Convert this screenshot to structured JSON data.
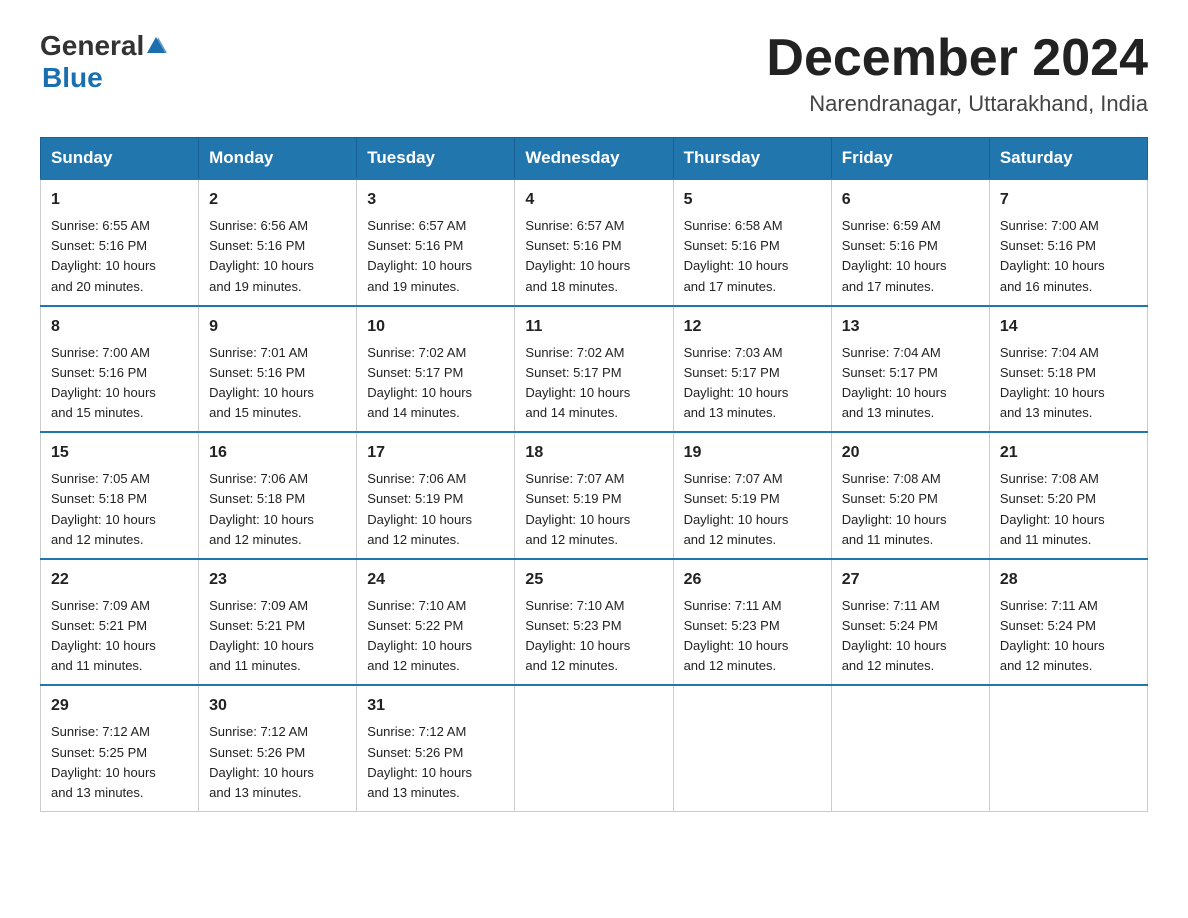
{
  "header": {
    "logo_text_general": "General",
    "logo_text_blue": "Blue",
    "month_year": "December 2024",
    "location": "Narendranagar, Uttarakhand, India"
  },
  "weekdays": [
    "Sunday",
    "Monday",
    "Tuesday",
    "Wednesday",
    "Thursday",
    "Friday",
    "Saturday"
  ],
  "weeks": [
    [
      {
        "day": "1",
        "sunrise": "6:55 AM",
        "sunset": "5:16 PM",
        "daylight": "10 hours and 20 minutes."
      },
      {
        "day": "2",
        "sunrise": "6:56 AM",
        "sunset": "5:16 PM",
        "daylight": "10 hours and 19 minutes."
      },
      {
        "day": "3",
        "sunrise": "6:57 AM",
        "sunset": "5:16 PM",
        "daylight": "10 hours and 19 minutes."
      },
      {
        "day": "4",
        "sunrise": "6:57 AM",
        "sunset": "5:16 PM",
        "daylight": "10 hours and 18 minutes."
      },
      {
        "day": "5",
        "sunrise": "6:58 AM",
        "sunset": "5:16 PM",
        "daylight": "10 hours and 17 minutes."
      },
      {
        "day": "6",
        "sunrise": "6:59 AM",
        "sunset": "5:16 PM",
        "daylight": "10 hours and 17 minutes."
      },
      {
        "day": "7",
        "sunrise": "7:00 AM",
        "sunset": "5:16 PM",
        "daylight": "10 hours and 16 minutes."
      }
    ],
    [
      {
        "day": "8",
        "sunrise": "7:00 AM",
        "sunset": "5:16 PM",
        "daylight": "10 hours and 15 minutes."
      },
      {
        "day": "9",
        "sunrise": "7:01 AM",
        "sunset": "5:16 PM",
        "daylight": "10 hours and 15 minutes."
      },
      {
        "day": "10",
        "sunrise": "7:02 AM",
        "sunset": "5:17 PM",
        "daylight": "10 hours and 14 minutes."
      },
      {
        "day": "11",
        "sunrise": "7:02 AM",
        "sunset": "5:17 PM",
        "daylight": "10 hours and 14 minutes."
      },
      {
        "day": "12",
        "sunrise": "7:03 AM",
        "sunset": "5:17 PM",
        "daylight": "10 hours and 13 minutes."
      },
      {
        "day": "13",
        "sunrise": "7:04 AM",
        "sunset": "5:17 PM",
        "daylight": "10 hours and 13 minutes."
      },
      {
        "day": "14",
        "sunrise": "7:04 AM",
        "sunset": "5:18 PM",
        "daylight": "10 hours and 13 minutes."
      }
    ],
    [
      {
        "day": "15",
        "sunrise": "7:05 AM",
        "sunset": "5:18 PM",
        "daylight": "10 hours and 12 minutes."
      },
      {
        "day": "16",
        "sunrise": "7:06 AM",
        "sunset": "5:18 PM",
        "daylight": "10 hours and 12 minutes."
      },
      {
        "day": "17",
        "sunrise": "7:06 AM",
        "sunset": "5:19 PM",
        "daylight": "10 hours and 12 minutes."
      },
      {
        "day": "18",
        "sunrise": "7:07 AM",
        "sunset": "5:19 PM",
        "daylight": "10 hours and 12 minutes."
      },
      {
        "day": "19",
        "sunrise": "7:07 AM",
        "sunset": "5:19 PM",
        "daylight": "10 hours and 12 minutes."
      },
      {
        "day": "20",
        "sunrise": "7:08 AM",
        "sunset": "5:20 PM",
        "daylight": "10 hours and 11 minutes."
      },
      {
        "day": "21",
        "sunrise": "7:08 AM",
        "sunset": "5:20 PM",
        "daylight": "10 hours and 11 minutes."
      }
    ],
    [
      {
        "day": "22",
        "sunrise": "7:09 AM",
        "sunset": "5:21 PM",
        "daylight": "10 hours and 11 minutes."
      },
      {
        "day": "23",
        "sunrise": "7:09 AM",
        "sunset": "5:21 PM",
        "daylight": "10 hours and 11 minutes."
      },
      {
        "day": "24",
        "sunrise": "7:10 AM",
        "sunset": "5:22 PM",
        "daylight": "10 hours and 12 minutes."
      },
      {
        "day": "25",
        "sunrise": "7:10 AM",
        "sunset": "5:23 PM",
        "daylight": "10 hours and 12 minutes."
      },
      {
        "day": "26",
        "sunrise": "7:11 AM",
        "sunset": "5:23 PM",
        "daylight": "10 hours and 12 minutes."
      },
      {
        "day": "27",
        "sunrise": "7:11 AM",
        "sunset": "5:24 PM",
        "daylight": "10 hours and 12 minutes."
      },
      {
        "day": "28",
        "sunrise": "7:11 AM",
        "sunset": "5:24 PM",
        "daylight": "10 hours and 12 minutes."
      }
    ],
    [
      {
        "day": "29",
        "sunrise": "7:12 AM",
        "sunset": "5:25 PM",
        "daylight": "10 hours and 13 minutes."
      },
      {
        "day": "30",
        "sunrise": "7:12 AM",
        "sunset": "5:26 PM",
        "daylight": "10 hours and 13 minutes."
      },
      {
        "day": "31",
        "sunrise": "7:12 AM",
        "sunset": "5:26 PM",
        "daylight": "10 hours and 13 minutes."
      },
      null,
      null,
      null,
      null
    ]
  ],
  "labels": {
    "sunrise": "Sunrise:",
    "sunset": "Sunset:",
    "daylight": "Daylight:"
  }
}
